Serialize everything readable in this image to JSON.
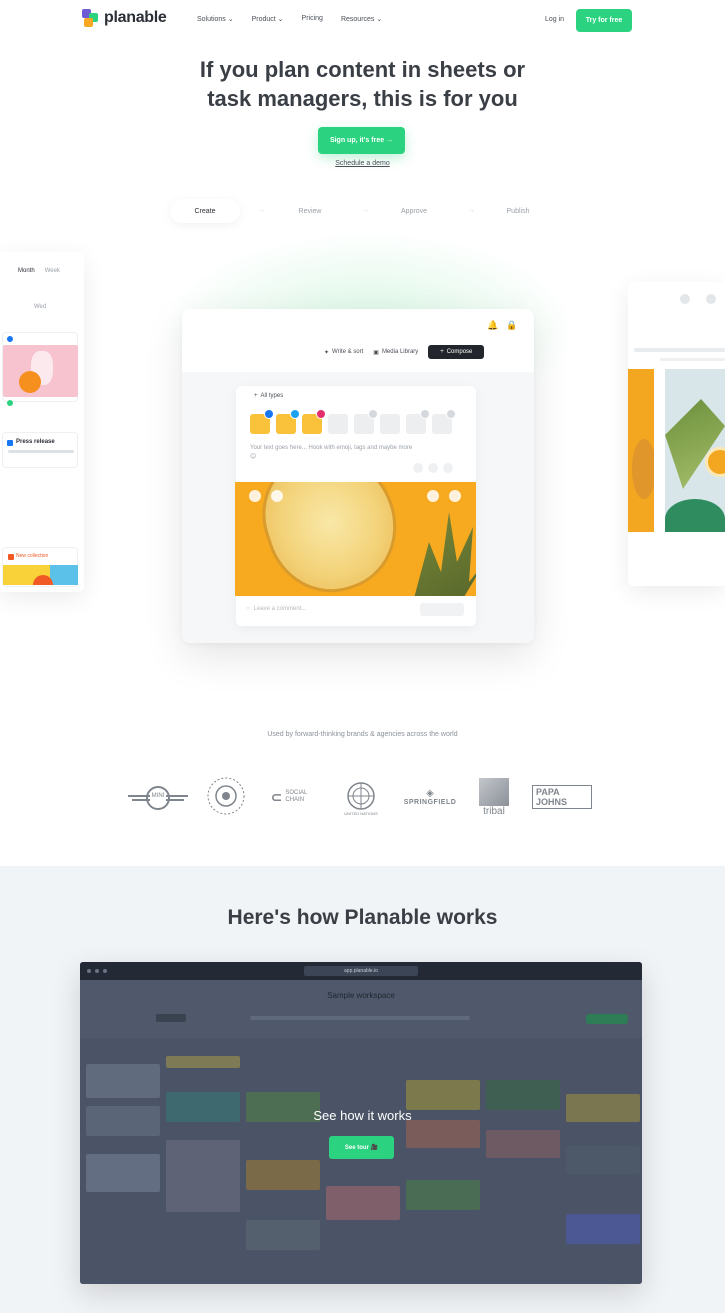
{
  "nav": {
    "logo_text": "planable",
    "links": [
      "Solutions",
      "Product",
      "Pricing",
      "Resources"
    ],
    "login": "Log in",
    "signup": "Try for free"
  },
  "hero": {
    "title_line1": "If you plan content in sheets or",
    "title_line2": "task managers, this is for you",
    "cta": "Sign up, it's free →",
    "demo_link": "Schedule a demo",
    "steps": [
      "Create",
      "Review",
      "Approve",
      "Publish"
    ]
  },
  "side_left": {
    "toggle_month": "Month",
    "toggle_week": "Week",
    "date": "Wed",
    "card2_title": "Press release",
    "card3_title": "New collection"
  },
  "editor": {
    "toolbar_ai": "Write & sort",
    "toolbar_library": "Media Library",
    "toolbar_button": "Compose",
    "post_label": "All types",
    "post_text": "Your text goes here... Hook with emoji, tags and maybe more 😊",
    "post_footer": "Leave a comment...",
    "colors": {
      "facebook": "#1877f2",
      "twitter": "#1da1f2",
      "instagram": "#e1306c",
      "channel_active": "#f9c23a"
    }
  },
  "brands": {
    "used_by": "Used by forward-thinking brands & agencies across the world",
    "logos": [
      "MINI",
      "Sunflower",
      "SOCIAL CHAIN",
      "UNITED NATIONS",
      "SPRINGFIELD",
      "tribal",
      "PAPA JOHNS"
    ]
  },
  "how": {
    "title": "Here's how Planable works",
    "video_url": "app.planable.io",
    "video_title": "Sample workspace",
    "overlay_title": "See how it works",
    "overlay_button": "See tour 🎥"
  },
  "colors": {
    "accent": "#2bd27f",
    "text": "#3a3e45",
    "section_bg": "#f1f4f7"
  }
}
